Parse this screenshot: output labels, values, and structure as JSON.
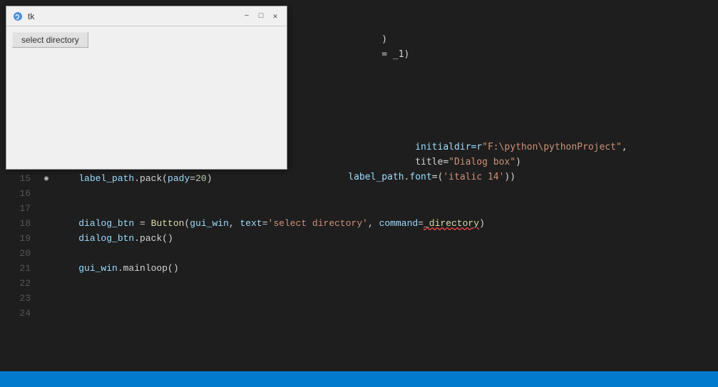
{
  "window": {
    "title": "tk",
    "controls": {
      "minimize": "−",
      "maximize": "□",
      "close": "✕"
    },
    "button_label": "select directory"
  },
  "editor": {
    "lines": [
      {
        "num": "15",
        "has_breakpoint": true,
        "code": [
          {
            "text": "    label_path.pack(",
            "class": "tx"
          },
          {
            "text": "pady",
            "class": "nm"
          },
          {
            "text": "=",
            "class": "op"
          },
          {
            "text": "20",
            "class": "nu"
          },
          {
            "text": ")",
            "class": "tx"
          }
        ]
      },
      {
        "num": "16",
        "code": []
      },
      {
        "num": "17",
        "code": []
      },
      {
        "num": "18",
        "code": [
          {
            "text": "    dialog_btn = Button(",
            "class": "tx"
          },
          {
            "text": "gui_win",
            "class": "nm"
          },
          {
            "text": ", ",
            "class": "tx"
          },
          {
            "text": "text",
            "class": "nm"
          },
          {
            "text": "=",
            "class": "op"
          },
          {
            "text": "'select directory'",
            "class": "st"
          },
          {
            "text": ", ",
            "class": "tx"
          },
          {
            "text": "command",
            "class": "nm"
          },
          {
            "text": "=",
            "class": "op"
          },
          {
            "text": "_directory",
            "class": "fn"
          },
          {
            "text": ")",
            "class": "tx"
          }
        ]
      },
      {
        "num": "19",
        "code": [
          {
            "text": "    dialog_btn.pack()",
            "class": "tx"
          }
        ]
      },
      {
        "num": "20",
        "code": []
      },
      {
        "num": "21",
        "code": [
          {
            "text": "    gui_win.mainloop()",
            "class": "tx"
          }
        ]
      },
      {
        "num": "22",
        "code": []
      },
      {
        "num": "23",
        "code": []
      },
      {
        "num": "24",
        "code": []
      }
    ],
    "partial_lines_top": [
      {
        "code": [
          {
            "text": "                )",
            "class": "tx"
          }
        ]
      },
      {
        "code": [
          {
            "text": "                ",
            "class": "tx"
          },
          {
            "text": "= _1",
            "class": "tx"
          }
        ]
      }
    ],
    "partial_lines_mid": [
      {
        "code": [
          {
            "text": "                initialdir=r\"F:\\python\\pythonProject\"",
            "class": "st"
          },
          {
            "text": ",",
            "class": "tx"
          }
        ]
      },
      {
        "code": [
          {
            "text": "                title=",
            "class": "tx"
          },
          {
            "text": "\"Dialog box\"",
            "class": "st"
          },
          {
            "text": ")",
            "class": "tx"
          }
        ]
      },
      {
        "code": [
          {
            "text": "    label_path",
            "class": "nm"
          },
          {
            "text": ".",
            "class": "tx"
          },
          {
            "text": "font",
            "class": "nm"
          },
          {
            "text": "=(",
            "class": "tx"
          },
          {
            "text": "'italic 14'",
            "class": "st"
          },
          {
            "text": "))",
            "class": "tx"
          }
        ]
      }
    ]
  },
  "status_bar": {
    "text": ""
  }
}
